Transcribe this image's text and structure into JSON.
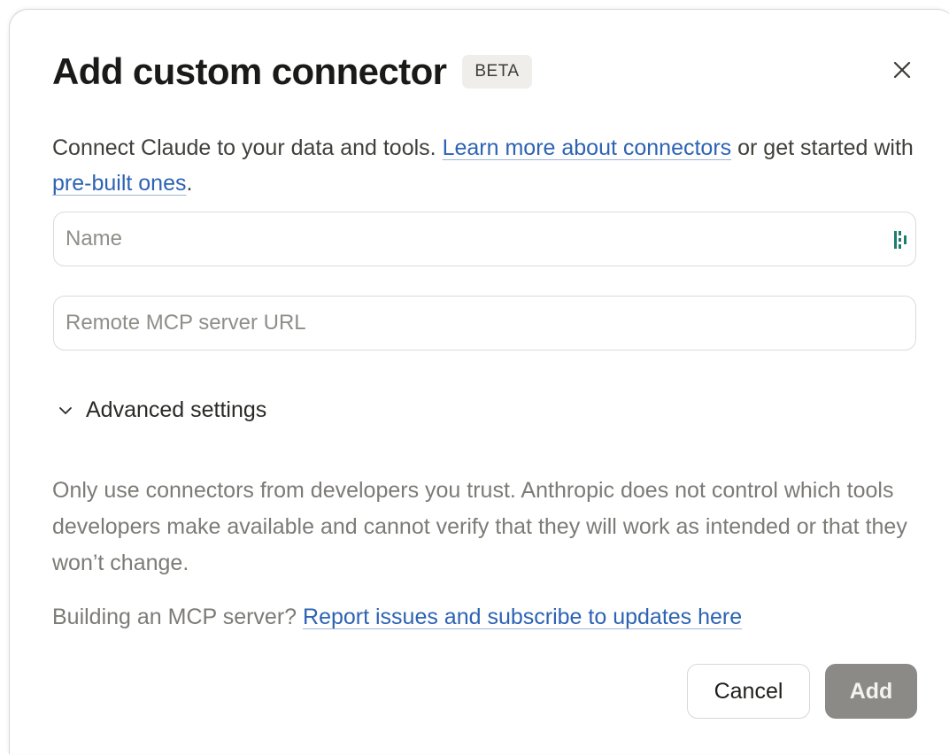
{
  "dialog": {
    "title": "Add custom connector",
    "badge": "BETA",
    "close_icon": "close-icon",
    "intro": {
      "text_before": "Connect Claude to your data and tools. ",
      "link1": "Learn more about connectors",
      "text_middle": " or get started with ",
      "link2": "pre-built ones",
      "text_after": "."
    },
    "fields": {
      "name_placeholder": "Name",
      "name_value": "",
      "url_placeholder": "Remote MCP server URL",
      "url_value": ""
    },
    "advanced_label": "Advanced settings",
    "warning": "Only use connectors from developers you trust. Anthropic does not control which tools developers make available and cannot verify that they will work as intended or that they won’t change.",
    "building": {
      "prefix": "Building an MCP server? ",
      "link": "Report issues and subscribe to updates here"
    },
    "buttons": {
      "cancel": "Cancel",
      "add": "Add"
    }
  },
  "colors": {
    "link": "#2d63b3",
    "add_button_disabled": "#8b8a86",
    "beta_badge_bg": "#efeeea",
    "password_manager_icon": "#1e7d6d"
  }
}
